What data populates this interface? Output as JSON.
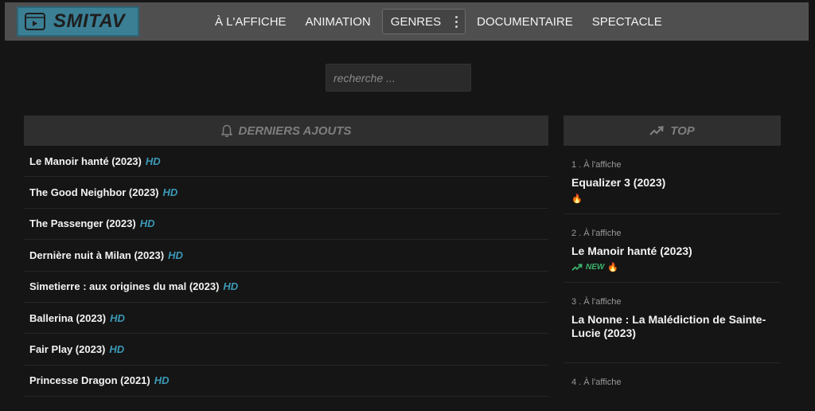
{
  "brand": {
    "name": "SMITAV",
    "color": "#3b7f95"
  },
  "nav": {
    "items": [
      "À L'AFFICHE",
      "ANIMATION",
      "GENRES",
      "DOCUMENTAIRE",
      "SPECTACLE"
    ]
  },
  "search": {
    "placeholder": "recherche ..."
  },
  "latest": {
    "title": "DERNIERS AJOUTS",
    "icon": "bell-icon",
    "items": [
      {
        "title": "Le Manoir hanté (2023)",
        "quality": "HD"
      },
      {
        "title": "The Good Neighbor (2023)",
        "quality": "HD"
      },
      {
        "title": "The Passenger (2023)",
        "quality": "HD"
      },
      {
        "title": "Dernière nuit à Milan (2023)",
        "quality": "HD"
      },
      {
        "title": "Simetierre : aux origines du mal (2023)",
        "quality": "HD"
      },
      {
        "title": "Ballerina (2023)",
        "quality": "HD"
      },
      {
        "title": "Fair Play (2023)",
        "quality": "HD"
      },
      {
        "title": "Princesse Dragon (2021)",
        "quality": "HD"
      }
    ]
  },
  "top": {
    "title": "TOP",
    "icon": "trending-up-icon",
    "items": [
      {
        "rank": "1 . À l'affiche",
        "title": "Equalizer 3 (2023)",
        "new": "",
        "fire": "🔥"
      },
      {
        "rank": "2 . À l'affiche",
        "title": "Le Manoir hanté (2023)",
        "new": "NEW",
        "fire": "🔥"
      },
      {
        "rank": "3 . À l'affiche",
        "title": "La Nonne : La Malédiction de Sainte-Lucie (2023)",
        "new": "",
        "fire": ""
      },
      {
        "rank": "4 . À l'affiche",
        "title": "",
        "new": "",
        "fire": ""
      }
    ]
  },
  "colors": {
    "accent": "#3b9ab8",
    "new": "#3bb36a"
  }
}
